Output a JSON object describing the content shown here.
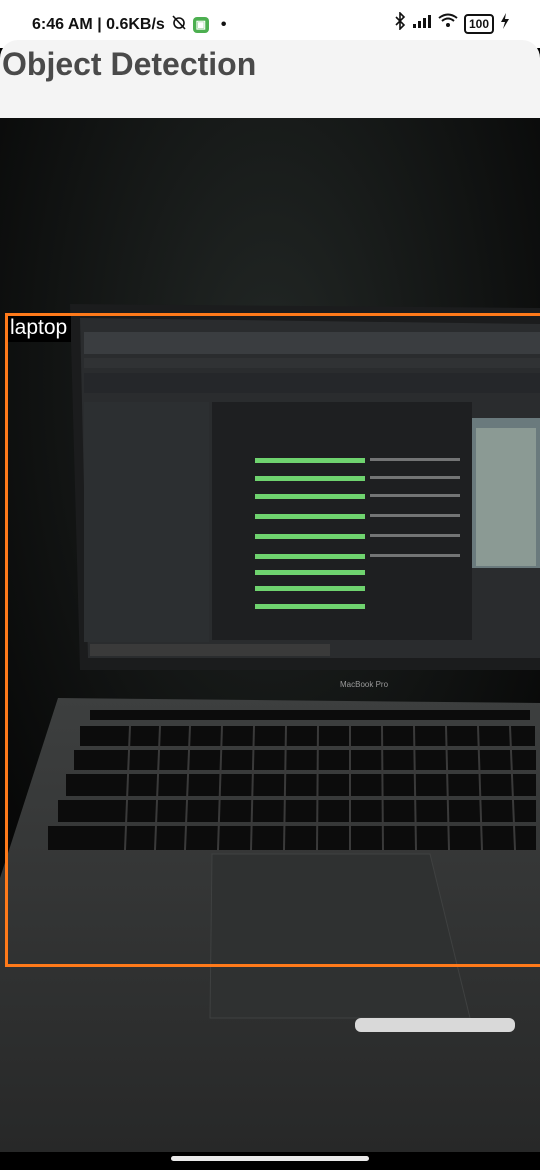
{
  "status_bar": {
    "time_speed": "6:46 AM | 0.6KB/s",
    "dot": "•",
    "battery": "100",
    "icons": [
      "alarm-off-icon",
      "app-notification-icon",
      "bluetooth-icon",
      "signal-icon",
      "wifi-icon",
      "battery-icon",
      "charging-icon"
    ]
  },
  "app": {
    "title": "Object Detection"
  },
  "detection": {
    "label": "laptop",
    "box_color": "#ff7a1a",
    "label_bg": "#000000",
    "label_color": "#ffffff"
  },
  "photo": {
    "subject": "laptop-photo",
    "brand_text": "MacBook Pro"
  }
}
